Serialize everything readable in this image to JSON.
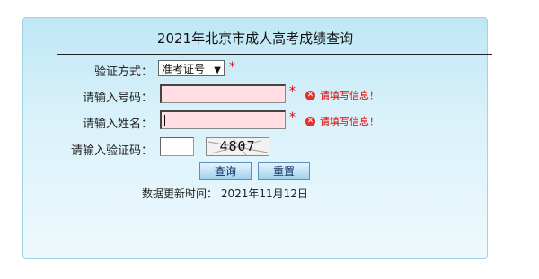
{
  "title": "2021年北京市成人高考成绩查询",
  "form": {
    "verify_method_label": "验证方式：",
    "verify_method_value": "准考证号",
    "number_label": "请输入号码：",
    "name_label": "请输入姓名：",
    "captcha_label": "请输入验证码：",
    "captcha_text": "4807",
    "required_mark": "*",
    "error_text": "请填写信息！",
    "error_icon_glyph": "✕"
  },
  "buttons": {
    "query_label": "查询",
    "reset_label": "重置"
  },
  "update_time": "数据更新时间： 2021年11月12日",
  "colors": {
    "error": "#e00000",
    "input_error_bg": "#ffdfe4",
    "panel_top": "#bfe7f6"
  }
}
